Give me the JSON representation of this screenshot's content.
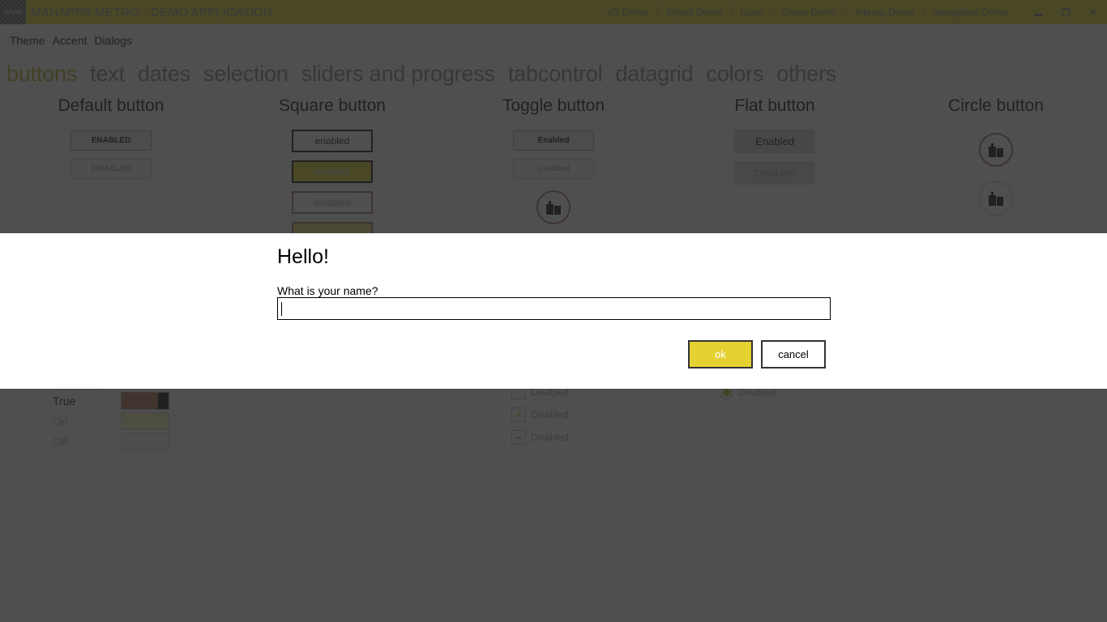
{
  "window": {
    "title": "MAHAPPS.METRO - DEMO APPLICATION",
    "commands": [
      "VS Demo",
      "Flyout Demo",
      "Icons",
      "Clean Demo",
      "Interop Demo",
      "Navigation Demo"
    ],
    "controls": {
      "minimize": "minimize",
      "maximize": "maximize",
      "close": "✕"
    }
  },
  "menu": [
    "Theme",
    "Accent",
    "Dialogs"
  ],
  "tabs": [
    {
      "label": "buttons",
      "active": true
    },
    {
      "label": "text",
      "active": false
    },
    {
      "label": "dates",
      "active": false
    },
    {
      "label": "selection",
      "active": false
    },
    {
      "label": "sliders and progress",
      "active": false
    },
    {
      "label": "tabcontrol",
      "active": false
    },
    {
      "label": "datagrid",
      "active": false
    },
    {
      "label": "colors",
      "active": false
    },
    {
      "label": "others",
      "active": false
    }
  ],
  "sections": {
    "default": {
      "title": "Default button",
      "enabled": "ENABLED",
      "disabled": "DISABLED"
    },
    "square": {
      "title": "Square button",
      "enabled": "enabled",
      "enabled_accent": "enabled",
      "disabled": "disabled"
    },
    "toggle": {
      "title": "Toggle button",
      "enabled": "Enabled",
      "disabled": "Disabled"
    },
    "flat": {
      "title": "Flat button",
      "enabled": "Enabled",
      "disabled": "Disabled"
    },
    "circle": {
      "title": "Circle button"
    }
  },
  "switches": {
    "true_label": "True",
    "on_label": "On",
    "off_label": "Off"
  },
  "checkboxes": [
    "Disabled",
    "Disabled",
    "Disabled"
  ],
  "radio": {
    "label": "Disabled"
  },
  "dialog": {
    "title": "Hello!",
    "message": "What is your name?",
    "input_value": "",
    "ok_label": "ok",
    "cancel_label": "cancel"
  },
  "colors": {
    "accent": "#e2d323",
    "active_tab": "#b8a912",
    "overlay": "rgba(40,40,40,0.82)"
  }
}
